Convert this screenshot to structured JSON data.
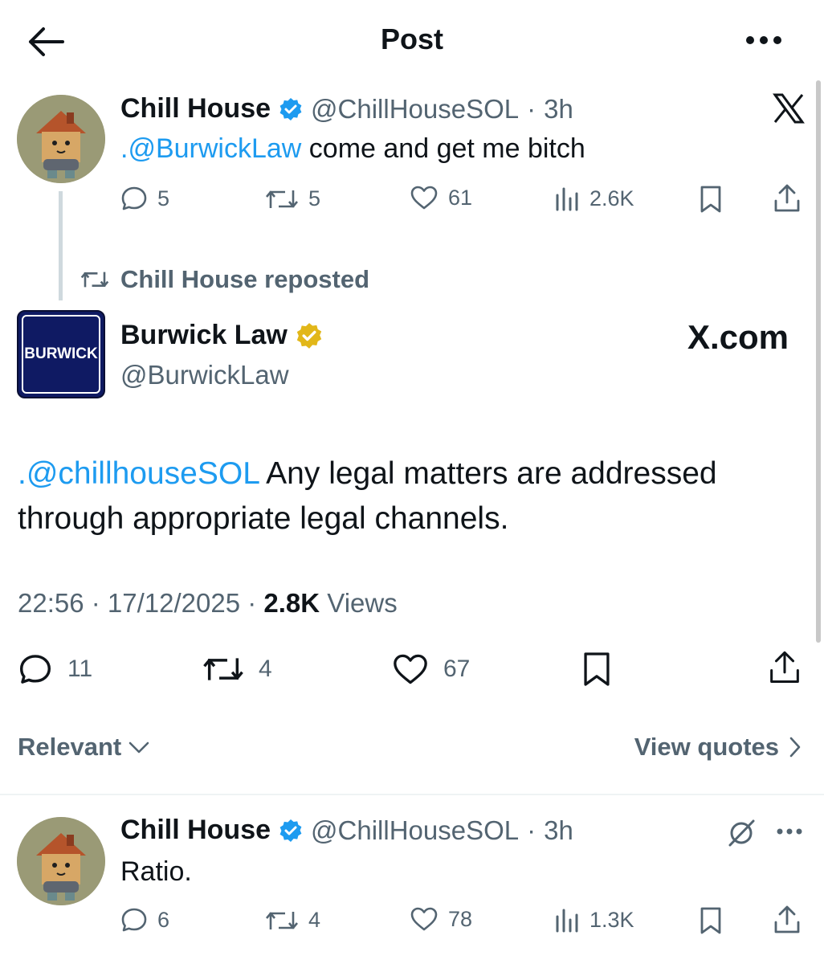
{
  "header": {
    "title": "Post"
  },
  "quoted_post": {
    "author_name": "Chill House",
    "handle": "@ChillHouseSOL",
    "time": "3h",
    "mention": ".@BurwickLaw",
    "text": " come and get me bitch",
    "stats": {
      "replies": "5",
      "reposts": "5",
      "likes": "61",
      "views": "2.6K"
    }
  },
  "repost_label": "Chill House reposted",
  "main_post": {
    "avatar_text": "BURWICK",
    "author_name": "Burwick Law",
    "handle": "@BurwickLaw",
    "brand": "X.com",
    "mention": ".@chillhouseSOL",
    "text_line1": " Any legal matters are addressed",
    "text_line2": "through appropriate legal channels.",
    "timestamp": "22:56 · 17/12/2025 · ",
    "views_count": "2.8K",
    "views_label": " Views",
    "stats": {
      "replies": "11",
      "reposts": "4",
      "likes": "67"
    }
  },
  "sort": {
    "label": "Relevant",
    "quotes_label": "View quotes"
  },
  "reply_post": {
    "author_name": "Chill House",
    "handle": "@ChillHouseSOL",
    "time": "3h",
    "text": "Ratio.",
    "stats": {
      "replies": "6",
      "reposts": "4",
      "likes": "78",
      "views": "1.3K"
    }
  },
  "colors": {
    "link": "#1d9bf0",
    "verified_blue": "#1d9bf0",
    "verified_gold": "#e2b719",
    "secondary": "#536471"
  }
}
